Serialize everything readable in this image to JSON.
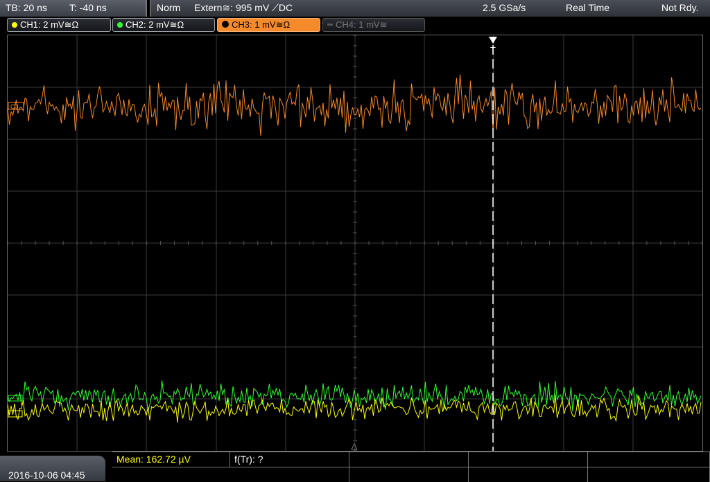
{
  "topbar": {
    "timebase": "TB: 20 ns",
    "trigger_pos": "T: -40 ns",
    "trigger_mode": "Norm",
    "trigger_source": "Extern≅: 995 mV ⟋DC",
    "sample_rate": "2.5 GSa/s",
    "acq_mode": "Real Time",
    "status": "Not Rdy."
  },
  "channels": [
    {
      "label": "CH1: 2 mV≅Ω",
      "color": "#ffff00",
      "state": "on"
    },
    {
      "label": "CH2: 2 mV≅Ω",
      "color": "#33ff33",
      "state": "on"
    },
    {
      "label": "CH3: 1 mV≅Ω",
      "color": "#f58a2a",
      "state": "active"
    },
    {
      "label": "CH4: 1 mV≅",
      "color": "#777777",
      "state": "off"
    }
  ],
  "markers": {
    "ch3": "C3",
    "trigger": "T"
  },
  "colors": {
    "ch1": "#ffff00",
    "ch2": "#33ff33",
    "ch3": "#f58a2a",
    "grid": "#3a3a3a"
  },
  "bottombar": {
    "datetime": "2016-10-06 04:45",
    "mean": "Mean: 162.72 µV",
    "freq": "f(Tr): ?"
  }
}
